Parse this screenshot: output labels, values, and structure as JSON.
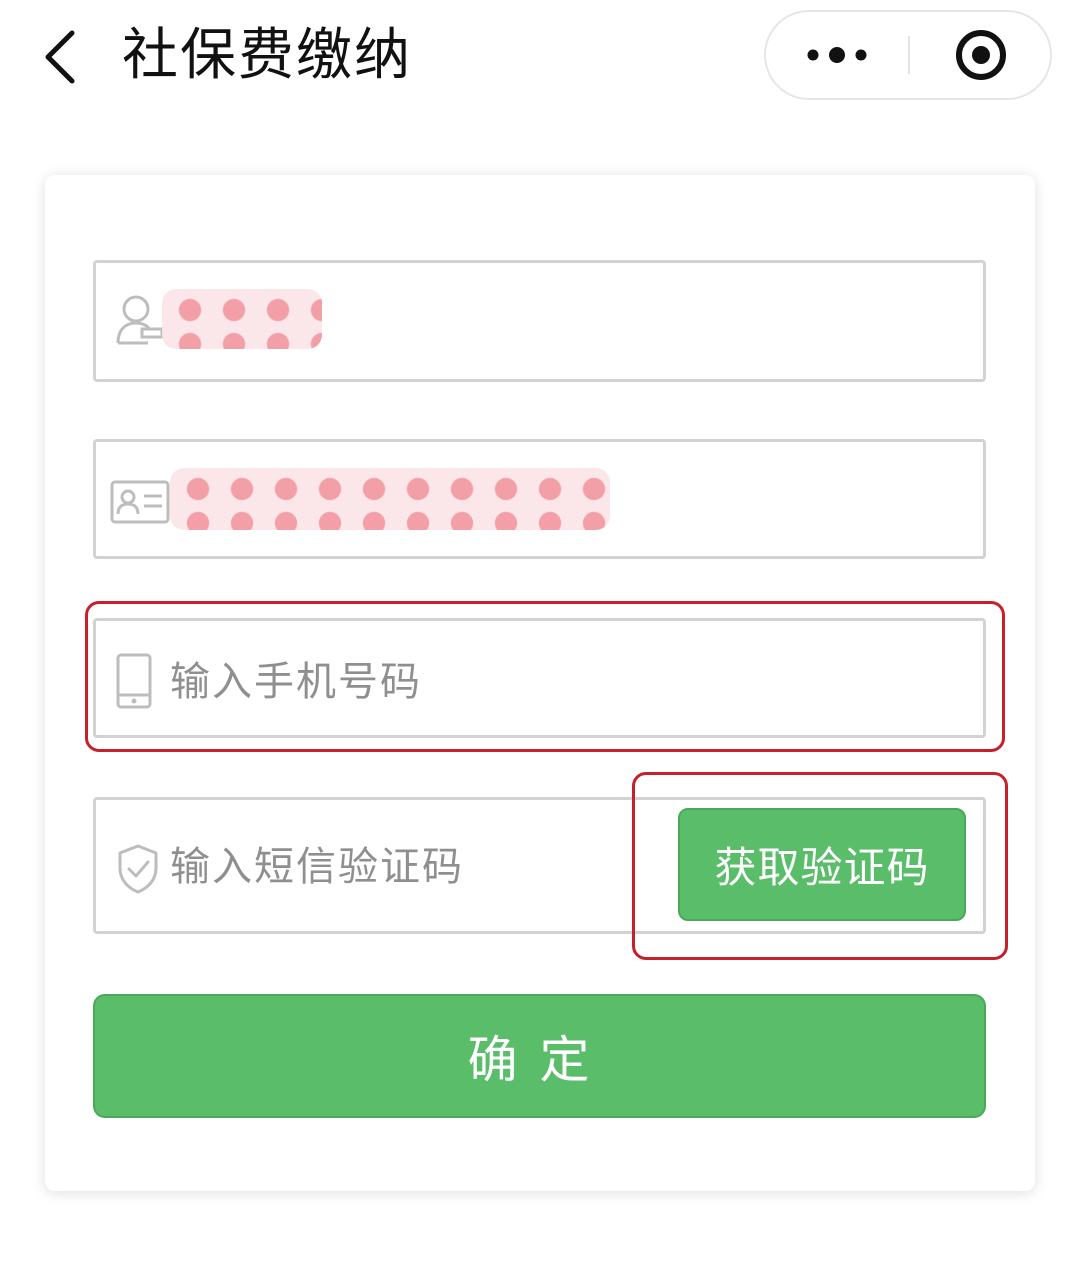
{
  "header": {
    "title": "社保费缴纳",
    "back_icon": "chevron-left-icon",
    "more_icon": "more-dots-icon",
    "close_icon": "target-close-icon"
  },
  "form": {
    "name_field": {
      "icon": "user-icon",
      "value_redacted": true
    },
    "id_field": {
      "icon": "id-card-icon",
      "value_redacted": true
    },
    "phone_field": {
      "icon": "phone-icon",
      "placeholder": "输入手机号码"
    },
    "sms_field": {
      "icon": "shield-check-icon",
      "placeholder": "输入短信验证码"
    },
    "sms_button_label": "获取验证码",
    "confirm_label": "确定"
  },
  "colors": {
    "primary_green": "#5abd69",
    "highlight_red": "#c8202b",
    "redaction_pink": "#f29aa3"
  }
}
